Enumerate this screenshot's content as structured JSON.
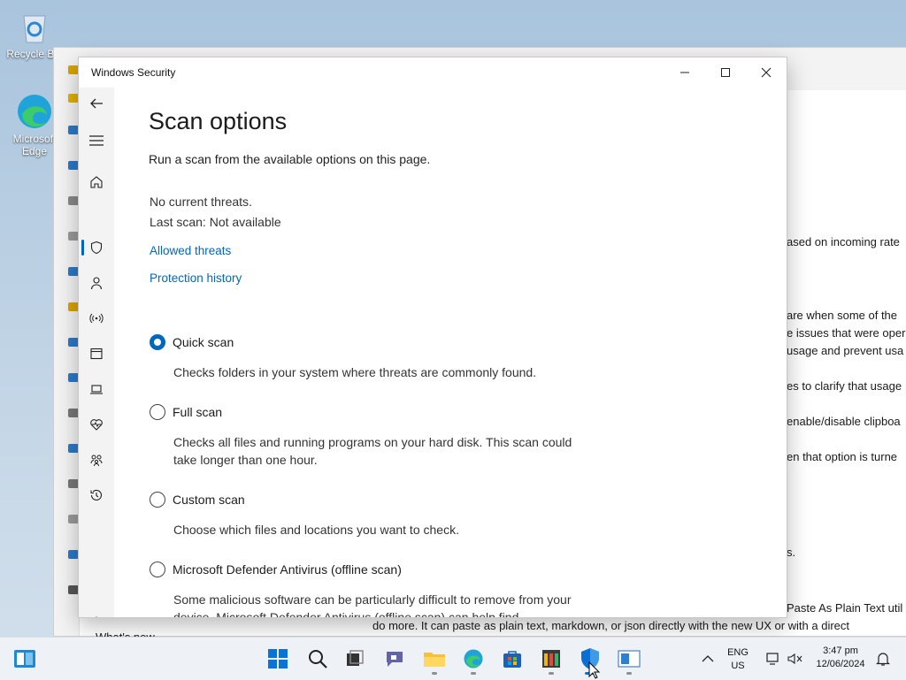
{
  "desktop": {
    "icons": [
      {
        "label": "Recycle Bin",
        "icon": "recycle-bin-icon"
      },
      {
        "label": "Microsoft Edge",
        "icon": "edge-icon"
      }
    ]
  },
  "background_window": {
    "lines": [
      "ased on incoming rate",
      "are when some of the",
      "e issues that were oper",
      "usage and prevent usa",
      "es to clarify that usage",
      "enable/disable clipboa",
      "en that option is turne",
      "s.",
      "Paste As Plain Text util",
      "do more. It can paste as plain text, markdown, or json directly with the new UX or with a direct",
      "What's new"
    ]
  },
  "window": {
    "title": "Windows Security",
    "controls": {
      "minimize": "minimize-icon",
      "maximize": "maximize-icon",
      "close": "close-icon"
    },
    "nav": [
      {
        "name": "back",
        "icon": "back-arrow-icon"
      },
      {
        "name": "menu",
        "icon": "hamburger-menu-icon"
      },
      {
        "name": "home",
        "icon": "home-icon"
      },
      {
        "name": "virus-protection",
        "icon": "shield-icon",
        "selected": true
      },
      {
        "name": "account-protection",
        "icon": "person-icon"
      },
      {
        "name": "firewall-network",
        "icon": "antenna-icon"
      },
      {
        "name": "app-browser-control",
        "icon": "app-window-icon"
      },
      {
        "name": "device-security",
        "icon": "laptop-icon"
      },
      {
        "name": "device-performance",
        "icon": "heart-pulse-icon"
      },
      {
        "name": "family-options",
        "icon": "family-icon"
      },
      {
        "name": "protection-history",
        "icon": "history-icon"
      },
      {
        "name": "settings",
        "icon": "gear-icon"
      }
    ],
    "page": {
      "title": "Scan options",
      "subtitle": "Run a scan from the available options on this page.",
      "status_threats": "No current threats.",
      "status_last_scan": "Last scan: Not available",
      "link_allowed": "Allowed threats",
      "link_history": "Protection history",
      "options": [
        {
          "label": "Quick scan",
          "description": "Checks folders in your system where threats are commonly found.",
          "selected": true
        },
        {
          "label": "Full scan",
          "description": "Checks all files and running programs on your hard disk. This scan could take longer than one hour.",
          "selected": false
        },
        {
          "label": "Custom scan",
          "description": "Choose which files and locations you want to check.",
          "selected": false
        },
        {
          "label": "Microsoft Defender Antivirus (offline scan)",
          "description": "Some malicious software can be particularly difficult to remove from your device. Microsoft Defender Antivirus (offline scan) can help find",
          "selected": false
        }
      ]
    }
  },
  "taskbar": {
    "widgets_icon": "widgets-icon",
    "apps": [
      "start-icon",
      "search-icon",
      "task-view-icon",
      "teams-chat-icon",
      "file-explorer-icon",
      "edge-icon",
      "store-icon",
      "powertoys-icon",
      "windows-security-icon",
      "notepad-icon"
    ],
    "tray": {
      "chevron": "chevron-up-icon",
      "lang_top": "ENG",
      "lang_bottom": "US",
      "time": "3:47 pm",
      "date": "12/06/2024"
    }
  },
  "colors": {
    "accent": "#0067c0",
    "nav_bg": "#f3f3f3",
    "taskbar_bg": "#eef2f7"
  }
}
